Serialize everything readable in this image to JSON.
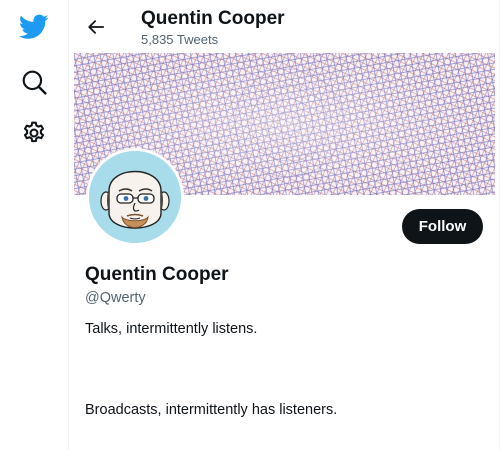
{
  "nav": {
    "icons": [
      "twitter-bird-icon",
      "explore-icon",
      "settings-icon"
    ],
    "accent_color": "#1d9bf0"
  },
  "header": {
    "name": "Quentin Cooper",
    "tweet_count": "5,835 Tweets"
  },
  "profile": {
    "display_name": "Quentin Cooper",
    "handle": "@Qwerty",
    "follow_label": "Follow",
    "bio_lines": [
      "Talks, intermittently listens.",
      "Broadcasts, intermittently has listeners."
    ]
  },
  "colors": {
    "text": "#0f1419",
    "muted": "#536471",
    "button_bg": "#0f1419",
    "avatar_bg": "#a8dcea",
    "banner_pattern": [
      "#6c6fc4",
      "#c27a8c"
    ]
  }
}
